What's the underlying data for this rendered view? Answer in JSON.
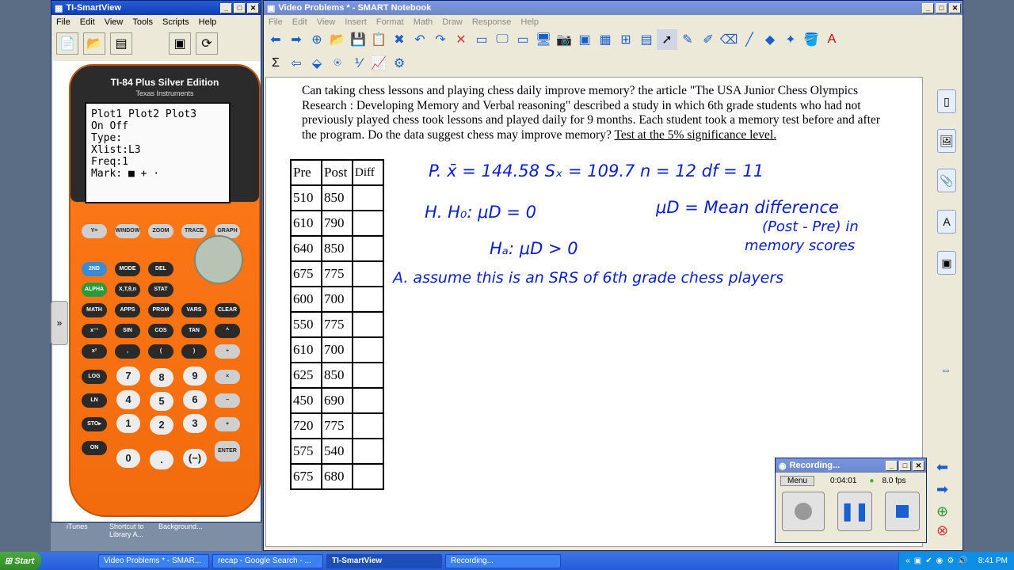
{
  "smartview": {
    "title": "TI-SmartView",
    "menu": [
      "File",
      "Edit",
      "View",
      "Tools",
      "Scripts",
      "Help"
    ],
    "calc_model": "TI-84 Plus Silver Edition",
    "calc_brand": "Texas Instruments",
    "screen_lines": [
      "Plot1 Plot2 Plot3",
      "On Off",
      "Type:",
      "Xlist:L3",
      "Freq:1",
      "Mark: ■ + ·"
    ],
    "keys": {
      "fn": [
        "Y=",
        "WINDOW",
        "ZOOM",
        "TRACE",
        "GRAPH"
      ],
      "fn_labels": [
        "STAT PLOT F1",
        "TBLSET F2",
        "FORMAT F3",
        "CALC F4",
        "TABLE F5"
      ],
      "row1": [
        "2ND",
        "MODE",
        "DEL"
      ],
      "row2": [
        "ALPHA",
        "X,T,θ,n",
        "STAT"
      ],
      "row3": [
        "MATH",
        "APPS",
        "PRGM",
        "VARS",
        "CLEAR"
      ],
      "row4": [
        "x⁻¹",
        "SIN",
        "COS",
        "TAN",
        "^"
      ],
      "row5": [
        "x²",
        ",",
        "(",
        ")",
        "÷"
      ],
      "row6": [
        "LOG",
        "7",
        "8",
        "9",
        "×"
      ],
      "row7": [
        "LN",
        "4",
        "5",
        "6",
        "−"
      ],
      "row8": [
        "STO▸",
        "1",
        "2",
        "3",
        "+"
      ],
      "row9": [
        "ON",
        "0",
        ".",
        "(−)",
        "ENTER"
      ]
    }
  },
  "desktop_icons": [
    "iTunes",
    "Shortcut to Library A...",
    "Background..."
  ],
  "notebook": {
    "title": "Video Problems * - SMART Notebook",
    "menu": [
      "File",
      "Edit",
      "View",
      "Insert",
      "Format",
      "Math",
      "Draw",
      "Response",
      "Help"
    ],
    "question": "Can taking chess lessons and playing chess daily improve memory?  the article \"The USA Junior Chess Olympics Research : Developing Memory and Verbal reasoning\" described a study in which 6th grade students who had not previously played chess took lessons and played daily for 9 months.  Each student took a memory test before and after the program.  Do the data suggest chess may improve memory?",
    "question_underlined": "Test at the 5% significance level.",
    "table": {
      "headers": [
        "Pre",
        "Post",
        "Diff"
      ],
      "rows": [
        [
          "510",
          "850",
          ""
        ],
        [
          "610",
          "790",
          ""
        ],
        [
          "640",
          "850",
          ""
        ],
        [
          "675",
          "775",
          ""
        ],
        [
          "600",
          "700",
          ""
        ],
        [
          "550",
          "775",
          ""
        ],
        [
          "610",
          "700",
          ""
        ],
        [
          "625",
          "850",
          ""
        ],
        [
          "450",
          "690",
          ""
        ],
        [
          "720",
          "775",
          ""
        ],
        [
          "575",
          "540",
          ""
        ],
        [
          "675",
          "680",
          ""
        ]
      ]
    },
    "handwriting": {
      "p_line": "P.  x̄ = 144.58   Sₓ = 109.7   n = 12   df = 11",
      "h_line": "H.  H₀: μD = 0",
      "ha_line": "Hₐ: μD > 0",
      "mu_def1": "μD = Mean difference",
      "mu_def2": "(Post - Pre) in",
      "mu_def3": "memory scores",
      "a_line": "A. assume this is an SRS of 6th grade chess players"
    }
  },
  "recording": {
    "title": "Recording...",
    "menu": "Menu",
    "time": "0:04:01",
    "fps": "8.0 fps"
  },
  "taskbar": {
    "start": "Start",
    "tasks": [
      "Video Problems * - SMAR...",
      "recap - Google Search - ...",
      "TI-SmartView",
      "Recording..."
    ],
    "clock": "8:41 PM"
  },
  "colors": {
    "ink": "#0a20d0",
    "calc_orange": "#f26b0c",
    "title_blue": "#0a3db5"
  }
}
